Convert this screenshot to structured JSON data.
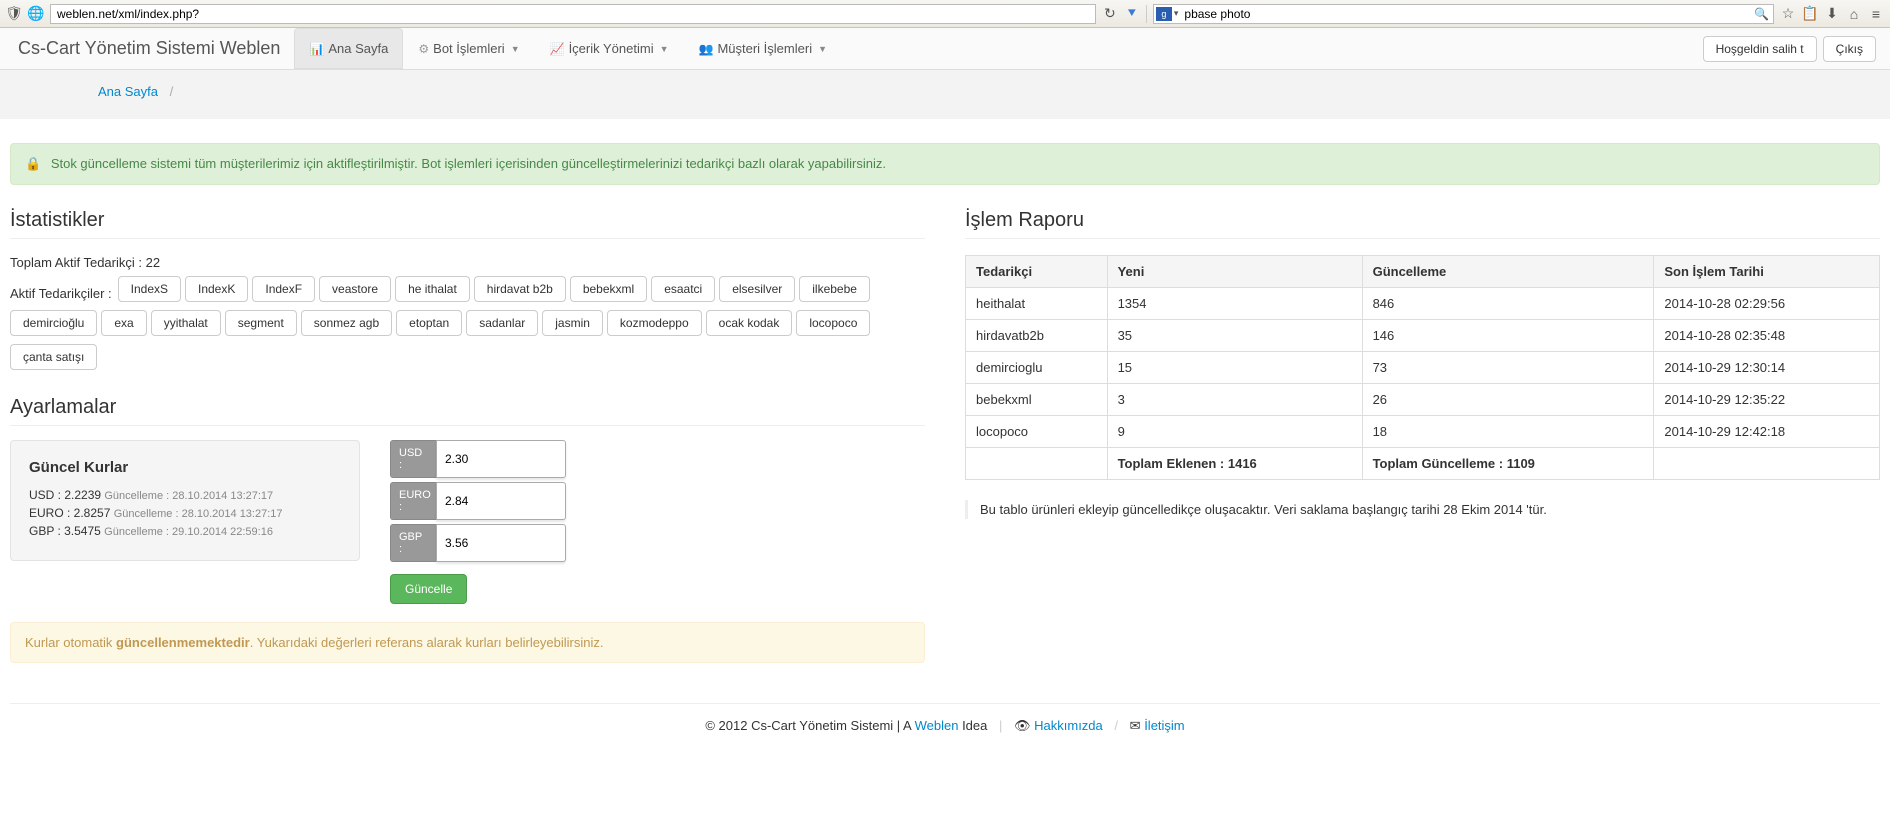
{
  "browser": {
    "url": "weblen.net/xml/index.php?",
    "search_engine_glyph": "g",
    "search_value": "pbase photo"
  },
  "nav": {
    "brand": "Cs-Cart Yönetim Sistemi Weblen",
    "items": [
      {
        "label": "Ana Sayfa",
        "dropdown": false,
        "active": true
      },
      {
        "label": "Bot İşlemleri",
        "dropdown": true,
        "active": false
      },
      {
        "label": "İçerik Yönetimi",
        "dropdown": true,
        "active": false
      },
      {
        "label": "Müşteri İşlemleri",
        "dropdown": true,
        "active": false
      }
    ],
    "welcome": "Hoşgeldin salih t",
    "logout": "Çıkış"
  },
  "breadcrumb": {
    "home": "Ana Sayfa"
  },
  "alert_info": "Stok güncelleme sistemi tüm müşterilerimiz için aktifleştirilmiştir. Bot işlemleri içerisinden güncelleştirmelerinizi tedarikçi bazlı olarak yapabilirsiniz.",
  "stats": {
    "title": "İstatistikler",
    "total_active_label": "Toplam Aktif Tedarikçi :",
    "total_active_value": "22",
    "active_list_label": "Aktif Tedarikçiler :",
    "suppliers": [
      "IndexS",
      "IndexK",
      "IndexF",
      "veastore",
      "he ithalat",
      "hirdavat b2b",
      "bebekxml",
      "esaatci",
      "elsesilver",
      "ilkebebe",
      "demircioğlu",
      "exa",
      "yyithalat",
      "segment",
      "sonmez agb",
      "etoptan",
      "sadanlar",
      "jasmin",
      "kozmodeppo",
      "ocak kodak",
      "locopoco",
      "çanta satışı"
    ]
  },
  "settings": {
    "title": "Ayarlamalar",
    "rates_box_title": "Güncel Kurlar",
    "rates": [
      {
        "label": "USD",
        "value": "2.2239",
        "upd_label": "Güncelleme :",
        "upd": "28.10.2014 13:27:17"
      },
      {
        "label": "EURO",
        "value": "2.8257",
        "upd_label": "Güncelleme :",
        "upd": "28.10.2014 13:27:17"
      },
      {
        "label": "GBP",
        "value": "3.5475",
        "upd_label": "Güncelleme :",
        "upd": "29.10.2014 22:59:16"
      }
    ],
    "inputs": [
      {
        "label": "USD :",
        "value": "2.30"
      },
      {
        "label": "EURO :",
        "value": "2.84"
      },
      {
        "label": "GBP :",
        "value": "3.56"
      }
    ],
    "update_btn": "Güncelle",
    "rates_warning_pre": "Kurlar otomatik ",
    "rates_warning_bold": "güncellenmemektedir",
    "rates_warning_post": ". Yukarıdaki değerleri referans alarak kurları belirleyebilirsiniz."
  },
  "report": {
    "title": "İşlem Raporu",
    "headers": [
      "Tedarikçi",
      "Yeni",
      "Güncelleme",
      "Son İşlem Tarihi"
    ],
    "rows": [
      [
        "heithalat",
        "1354",
        "846",
        "2014-10-28 02:29:56"
      ],
      [
        "hirdavatb2b",
        "35",
        "146",
        "2014-10-28 02:35:48"
      ],
      [
        "demircioglu",
        "15",
        "73",
        "2014-10-29 12:30:14"
      ],
      [
        "bebekxml",
        "3",
        "26",
        "2014-10-29 12:35:22"
      ],
      [
        "locopoco",
        "9",
        "18",
        "2014-10-29 12:42:18"
      ]
    ],
    "footer": {
      "new_label": "Toplam Eklenen :",
      "new_value": "1416",
      "upd_label": "Toplam Güncelleme :",
      "upd_value": "1109"
    },
    "note": "Bu tablo ürünleri ekleyip güncelledikçe oluşacaktır. Veri saklama başlangıç tarihi 28 Ekim 2014 'tür."
  },
  "footer": {
    "copy_pre": "© 2012 Cs-Cart Yönetim Sistemi | A ",
    "weblen": "Weblen",
    "idea": " Idea ",
    "about": "Hakkımızda",
    "contact": "İletişim"
  }
}
